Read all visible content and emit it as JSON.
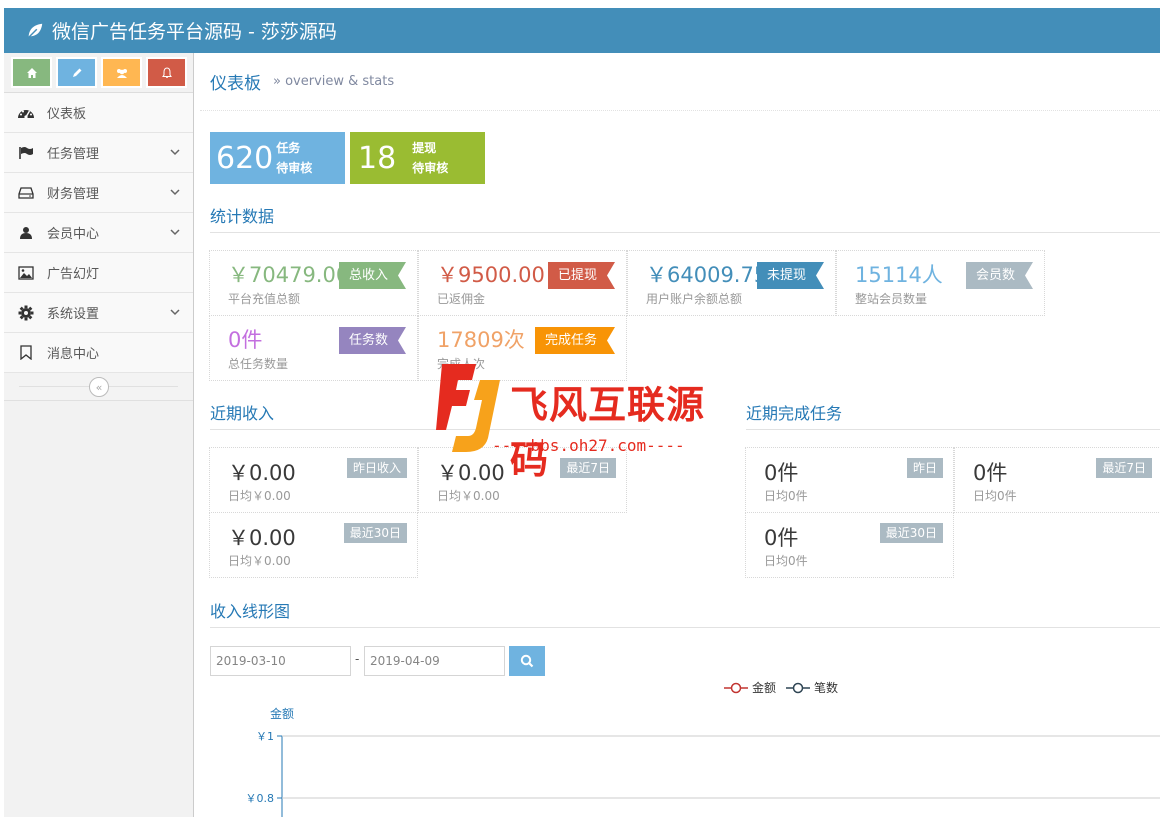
{
  "navbar": {
    "brand": "微信广告任务平台源码 - 莎莎源码"
  },
  "sidebar": {
    "items": [
      {
        "label": "仪表板",
        "icon": "dashboard-icon"
      },
      {
        "label": "任务管理",
        "icon": "flag-icon"
      },
      {
        "label": "财务管理",
        "icon": "hdd-icon"
      },
      {
        "label": "会员中心",
        "icon": "user-icon"
      },
      {
        "label": "广告幻灯",
        "icon": "picture-icon"
      },
      {
        "label": "系统设置",
        "icon": "gear-icon"
      },
      {
        "label": "消息中心",
        "icon": "bookmark-icon"
      }
    ]
  },
  "page": {
    "title": "仪表板",
    "subtitle": "» overview & stats"
  },
  "infoboxes": [
    {
      "num": "620",
      "line1": "任务",
      "line2": "待审核",
      "color": "#6fb3e0"
    },
    {
      "num": "18",
      "line1": "提现",
      "line2": "待审核",
      "color": "#9abc32"
    }
  ],
  "sections": {
    "stats": "统计数据",
    "income": "近期收入",
    "completed": "近期完成任务",
    "chart": "收入线形图"
  },
  "stats": [
    {
      "value": "￥70479.00",
      "desc": "平台充值总额",
      "badge": "总收入",
      "color": "#87b87f"
    },
    {
      "value": "￥9500.00",
      "desc": "已返佣金",
      "badge": "已提现",
      "color": "#d15b47"
    },
    {
      "value": "￥64009.75",
      "desc": "用户账户余额总额",
      "badge": "未提现",
      "color": "#438eb9"
    },
    {
      "value": "15114人",
      "desc": "整站会员数量",
      "badge": "会员数",
      "color": "#6fb3e0",
      "badge_color": "#abbac3"
    },
    {
      "value": "0件",
      "desc": "总任务数量",
      "badge": "任务数",
      "color": "#c36fdf",
      "badge_color": "#9585bf"
    },
    {
      "value": "17809次",
      "desc": "完成人次",
      "badge": "完成任务",
      "color": "#f0a267",
      "badge_color": "#f89406"
    }
  ],
  "income": [
    {
      "value": "￥0.00",
      "desc": "日均￥0.00",
      "tag": "昨日收入"
    },
    {
      "value": "￥0.00",
      "desc": "日均￥0.00",
      "tag": "最近7日"
    },
    {
      "value": "￥0.00",
      "desc": "日均￥0.00",
      "tag": "最近30日"
    }
  ],
  "completed": [
    {
      "value": "0件",
      "desc": "日均0件",
      "tag": "昨日"
    },
    {
      "value": "0件",
      "desc": "日均0件",
      "tag": "最近7日"
    },
    {
      "value": "0件",
      "desc": "日均0件",
      "tag": "最近30日"
    }
  ],
  "chart_controls": {
    "date_from": "2019-03-10",
    "date_sep": "-",
    "date_to": "2019-04-09"
  },
  "chart_data": {
    "type": "line",
    "series": [
      {
        "name": "金额",
        "values": [],
        "color": "#c23531"
      },
      {
        "name": "笔数",
        "values": [],
        "color": "#2f4554"
      }
    ],
    "ylabel": "金额",
    "ytick_labels": [
      "￥1",
      "￥0.8"
    ],
    "ylim": [
      0,
      1
    ]
  },
  "watermark": {
    "text": "飞风互联源码",
    "url": "----bbs.oh27.com----"
  }
}
